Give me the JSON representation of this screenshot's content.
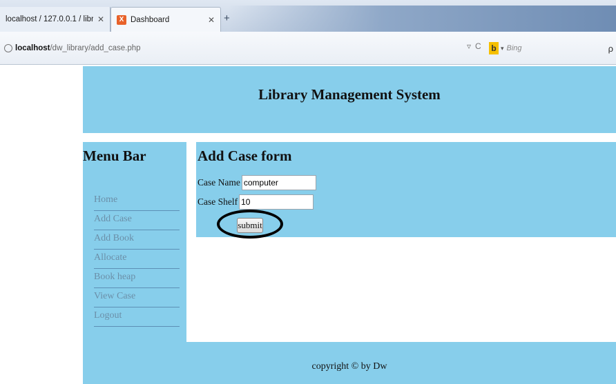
{
  "browser": {
    "tabs": [
      {
        "label": "localhost / 127.0.0.1 / librar..."
      },
      {
        "label": "Dashboard"
      }
    ],
    "address": {
      "host": "localhost",
      "path": "/dw_library/add_case.php"
    },
    "search": {
      "engine_placeholder": "Bing"
    }
  },
  "page": {
    "header_title": "Library Management System",
    "sidebar": {
      "title": "Menu Bar",
      "items": [
        {
          "label": "Home"
        },
        {
          "label": "Add Case"
        },
        {
          "label": "Add Book"
        },
        {
          "label": "Allocate"
        },
        {
          "label": "Book heap"
        },
        {
          "label": "View Case"
        },
        {
          "label": "Logout"
        }
      ]
    },
    "form": {
      "title": "Add Case form",
      "case_name_label": "Case Name",
      "case_name_value": "computer",
      "case_shelf_label": "Case Shelf",
      "case_shelf_value": "10",
      "submit_label": "submit"
    },
    "footer": "copyright © by Dw"
  },
  "colors": {
    "panel": "#87ceeb",
    "menu_link": "#6b8fa8"
  }
}
